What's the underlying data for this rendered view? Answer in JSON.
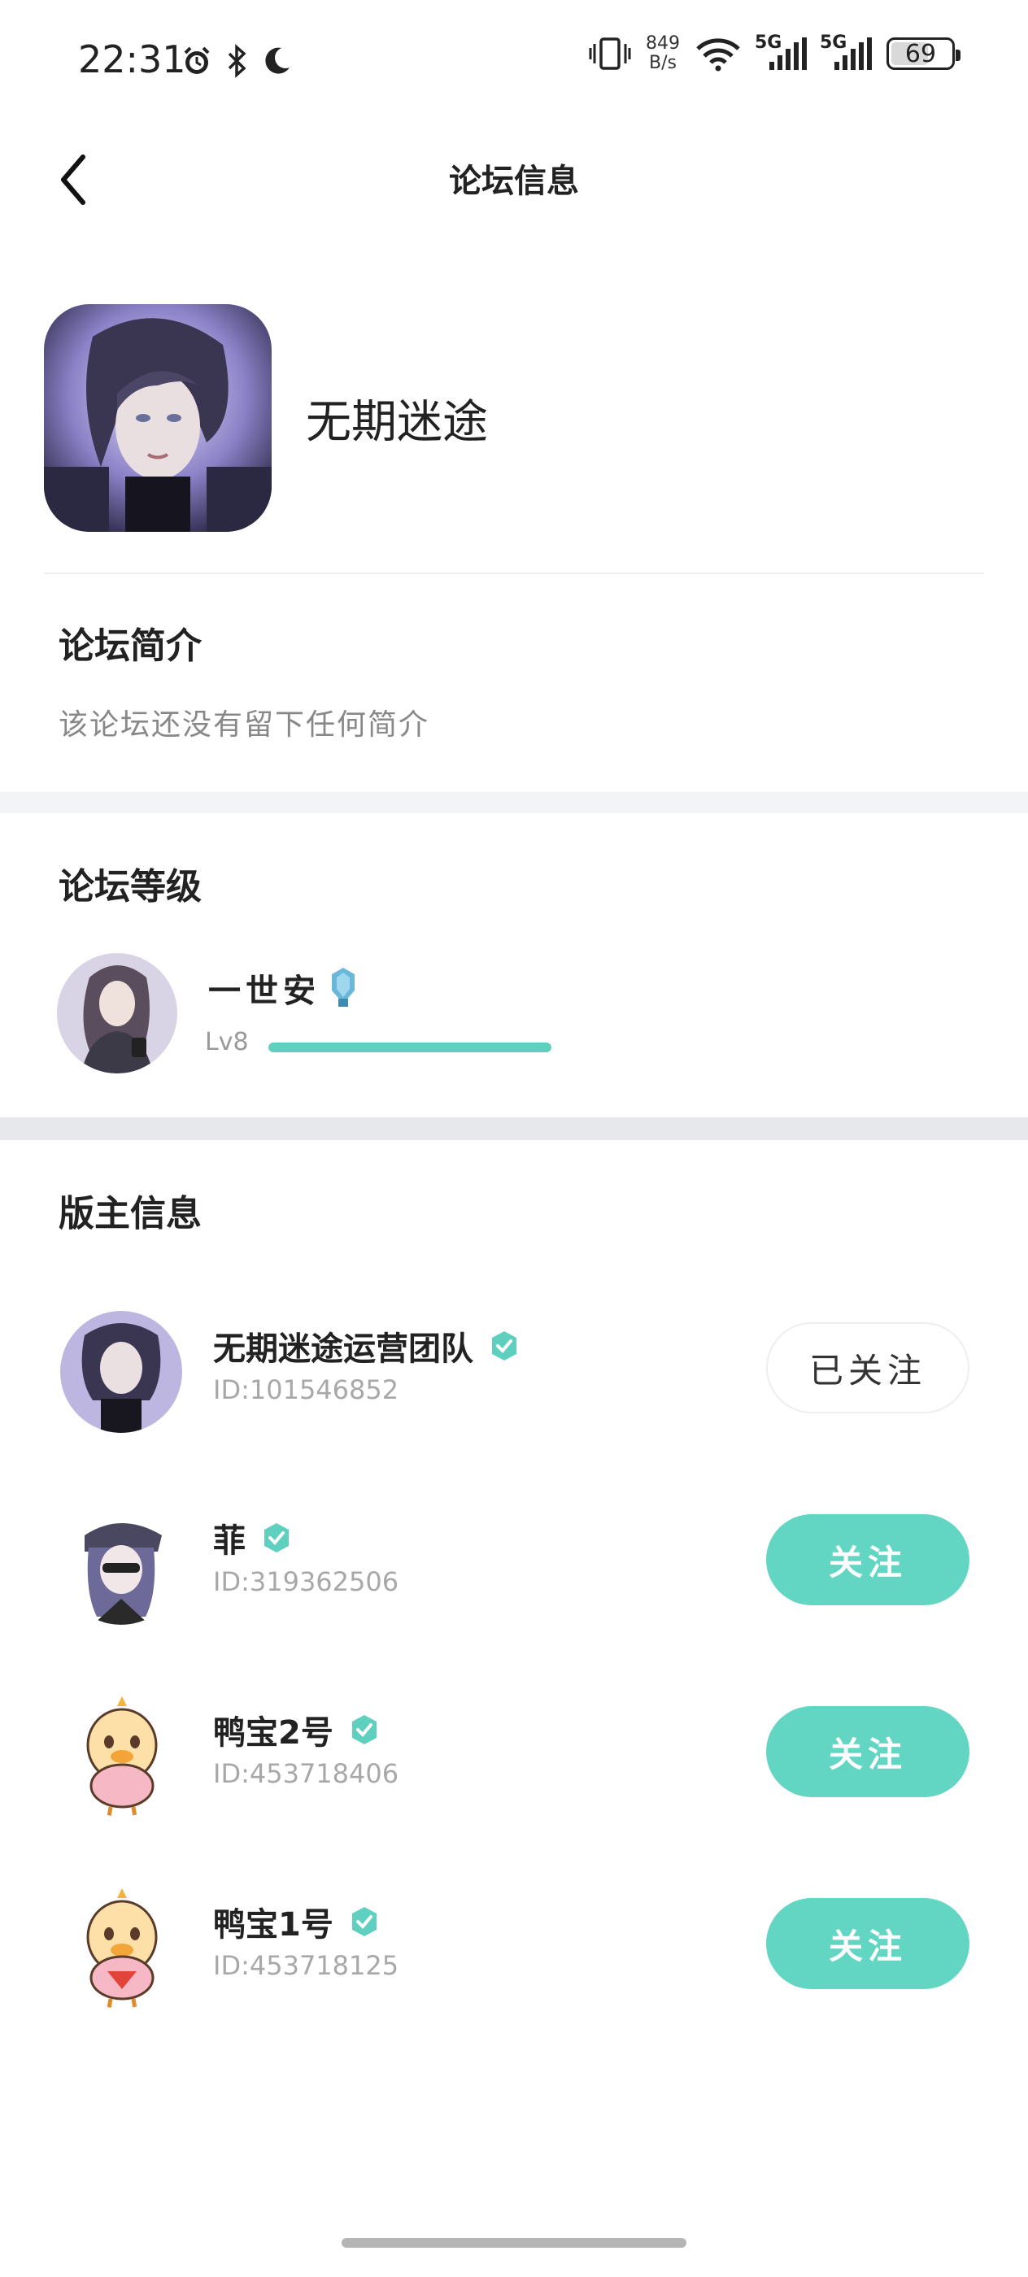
{
  "status_bar": {
    "time": "22:31",
    "net_speed_value": "849",
    "net_speed_unit": "B/s",
    "signal1_label": "5G",
    "signal2_label": "5G",
    "battery": "69",
    "icons": [
      "alarm-icon",
      "bluetooth-icon",
      "moon-icon",
      "vibrate-icon",
      "wifi-icon"
    ]
  },
  "nav": {
    "title": "论坛信息"
  },
  "forum": {
    "name": "无期迷途"
  },
  "intro": {
    "title": "论坛简介",
    "text": "该论坛还没有留下任何简介"
  },
  "level": {
    "title": "论坛等级",
    "user_name": "一世安",
    "level_label": "Lv8",
    "progress": 1.0,
    "accent": "#5fd0bf"
  },
  "moderators": {
    "title": "版主信息",
    "items": [
      {
        "name": "无期迷途运营团队",
        "id": "ID:101546852",
        "follow_label": "已关注",
        "followed": true
      },
      {
        "name": "菲",
        "id": "ID:319362506",
        "follow_label": "关注",
        "followed": false
      },
      {
        "name": "鸭宝2号",
        "id": "ID:453718406",
        "follow_label": "关注",
        "followed": false
      },
      {
        "name": "鸭宝1号",
        "id": "ID:453718125",
        "follow_label": "关注",
        "followed": false
      }
    ],
    "follow_color": "#62d6c3"
  }
}
